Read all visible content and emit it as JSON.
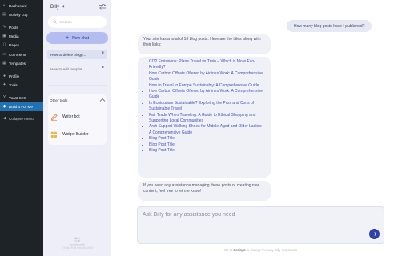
{
  "wp_menu": [
    {
      "label": "Dashboard",
      "icon": "dashboard-icon",
      "state": "normal"
    },
    {
      "label": "Activity Log",
      "icon": "activity-icon",
      "state": "normal"
    },
    {
      "label": "Posts",
      "icon": "pin-icon",
      "state": "normal"
    },
    {
      "label": "Media",
      "icon": "media-icon",
      "state": "normal"
    },
    {
      "label": "Pages",
      "icon": "page-icon",
      "state": "normal"
    },
    {
      "label": "Comments",
      "icon": "comment-icon",
      "state": "normal"
    },
    {
      "label": "Templates",
      "icon": "template-icon",
      "state": "normal"
    },
    {
      "label": "Profile",
      "icon": "profile-icon",
      "state": "normal"
    },
    {
      "label": "Tools",
      "icon": "wrench-icon",
      "state": "normal"
    },
    {
      "label": "Yoast SEO",
      "icon": "yoast-icon",
      "state": "normal"
    },
    {
      "label": "Build It For Me",
      "icon": "build-icon",
      "state": "active"
    },
    {
      "label": "Collapse menu",
      "icon": "collapse-icon",
      "state": "muted"
    }
  ],
  "billy": {
    "title": "Billy",
    "title_spark": "✦",
    "search_placeholder": "Search",
    "new_chat_label": "New chat",
    "chats": [
      {
        "label": "How to delete blogp...",
        "selected": true
      },
      {
        "label": "How to edit templat...",
        "selected": false
      }
    ],
    "other_tools_label": "Other tools",
    "tools": [
      {
        "label": "Writer bot",
        "icon": "pen-icon"
      },
      {
        "label": "Widget Builder",
        "icon": "widget-icon"
      }
    ],
    "brand_name": "BuildItForMe",
    "brand_copy": "© Build it for me, Inc 2024"
  },
  "conversation": {
    "user_message": "How many blog posts have I published?",
    "reply_intro": "Your site has a total of 10 blog posts. Here are the titles along with their links:",
    "posts": [
      "CO2 Emissions: Plane Travel vs Train – Which is More Eco-Friendly?",
      "How Carbon Offsets Offered by Airlines Work: A Comprehensive Guide",
      "How to Travel to Europe Sustainably: A Comprehensive Guide",
      "How Carbon Offsets Offered by Airlines Work: A Comprehensive Guide",
      "Is Ecotourism Sustainable? Exploring the Pros and Cons of Sustainable Travel",
      "Fair Trade When Traveling: A Guide to Ethical Shopping and Supporting Local Communities",
      "Arch Support Walking Shoes for Middle-Aged and Older Ladies: A Comprehensive Guide",
      "Blog Post Title",
      "Blog Post Title",
      "Blog Post Title"
    ],
    "reply_outro": "If you need any assistance managing these posts or creating new content, feel free to let me know!"
  },
  "composer": {
    "placeholder": "Ask Billy for any assistance you need"
  },
  "footer": {
    "prefix": "Go to ",
    "link": "Settings",
    "suffix": " to change the way Billy responses"
  },
  "colors": {
    "wp_sidebar": "#1d2327",
    "wp_active": "#2271b1",
    "billy_panel": "#edeef7",
    "new_chat": "#b4bdf0",
    "send_button": "#2f40a9",
    "link": "#4452b8"
  }
}
